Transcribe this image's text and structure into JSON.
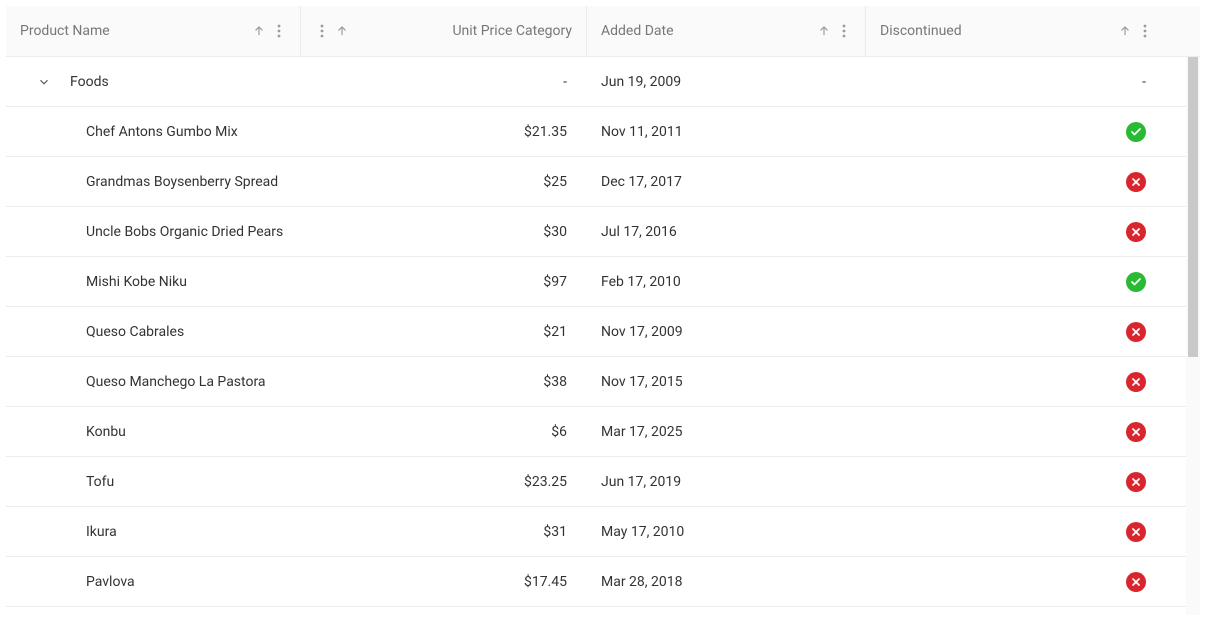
{
  "columns": {
    "product": "Product Name",
    "price": "Unit Price Category",
    "date": "Added Date",
    "discontinued": "Discontinued"
  },
  "group": {
    "label": "Foods",
    "price": "-",
    "date": "Jun 19, 2009",
    "discontinued": "-"
  },
  "rows": [
    {
      "name": "Chef Antons Gumbo Mix",
      "price": "$21.35",
      "date": "Nov 11, 2011",
      "discontinued": true
    },
    {
      "name": "Grandmas Boysenberry Spread",
      "price": "$25",
      "date": "Dec 17, 2017",
      "discontinued": false
    },
    {
      "name": "Uncle Bobs Organic Dried Pears",
      "price": "$30",
      "date": "Jul 17, 2016",
      "discontinued": false
    },
    {
      "name": "Mishi Kobe Niku",
      "price": "$97",
      "date": "Feb 17, 2010",
      "discontinued": true
    },
    {
      "name": "Queso Cabrales",
      "price": "$21",
      "date": "Nov 17, 2009",
      "discontinued": false
    },
    {
      "name": "Queso Manchego La Pastora",
      "price": "$38",
      "date": "Nov 17, 2015",
      "discontinued": false
    },
    {
      "name": "Konbu",
      "price": "$6",
      "date": "Mar 17, 2025",
      "discontinued": false
    },
    {
      "name": "Tofu",
      "price": "$23.25",
      "date": "Jun 17, 2019",
      "discontinued": false
    },
    {
      "name": "Ikura",
      "price": "$31",
      "date": "May 17, 2010",
      "discontinued": false
    },
    {
      "name": "Pavlova",
      "price": "$17.45",
      "date": "Mar 28, 2018",
      "discontinued": false
    }
  ]
}
